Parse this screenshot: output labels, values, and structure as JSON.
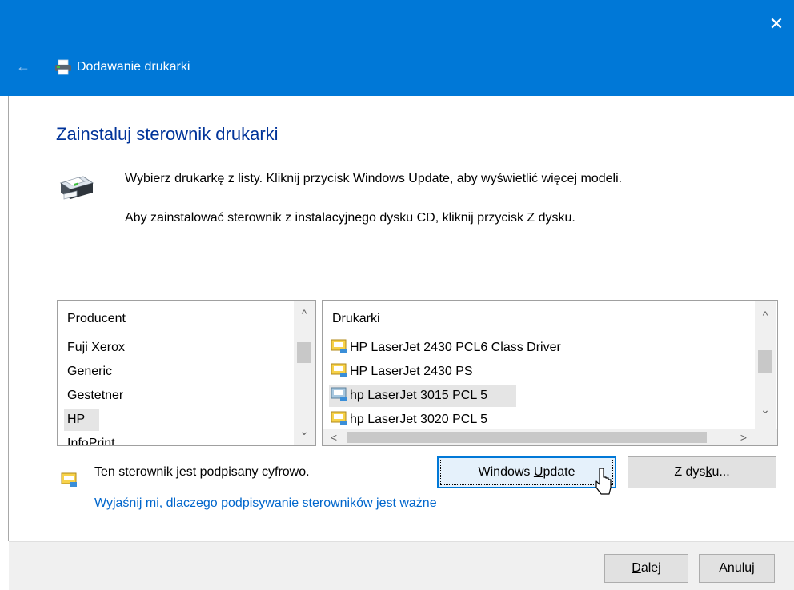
{
  "window": {
    "title": "Dodawanie drukarki",
    "close_glyph": "✕",
    "back_glyph": "←",
    "accent_color": "#0078d7"
  },
  "page": {
    "heading": "Zainstaluj sterownik drukarki",
    "description_line1": "Wybierz drukarkę z listy. Kliknij przycisk Windows Update, aby wyświetlić więcej modeli.",
    "description_line2": "Aby zainstalować sterownik z instalacyjnego dysku CD, kliknij przycisk Z dysku."
  },
  "manufacturers": {
    "header": "Producent",
    "items": [
      "Fuji Xerox",
      "Generic",
      "Gestetner",
      "HP",
      "InfoPrint"
    ],
    "selected": "HP"
  },
  "printers": {
    "header": "Drukarki",
    "items": [
      "HP LaserJet 2430 PCL6 Class Driver",
      "HP LaserJet 2430 PS",
      "hp LaserJet 3015 PCL 5",
      "hp LaserJet 3020 PCL 5"
    ],
    "selected": "hp LaserJet 3015 PCL 5"
  },
  "signature": {
    "text": "Ten sterownik jest podpisany cyfrowo.",
    "link": "Wyjaśnij mi, dlaczego podpisywanie sterowników jest ważne"
  },
  "buttons": {
    "windows_update_pre": "Windows ",
    "windows_update_key": "U",
    "windows_update_post": "pdate",
    "from_disk_pre": "Z dys",
    "from_disk_key": "k",
    "from_disk_post": "u...",
    "next_key": "D",
    "next_post": "alej",
    "cancel": "Anuluj"
  }
}
